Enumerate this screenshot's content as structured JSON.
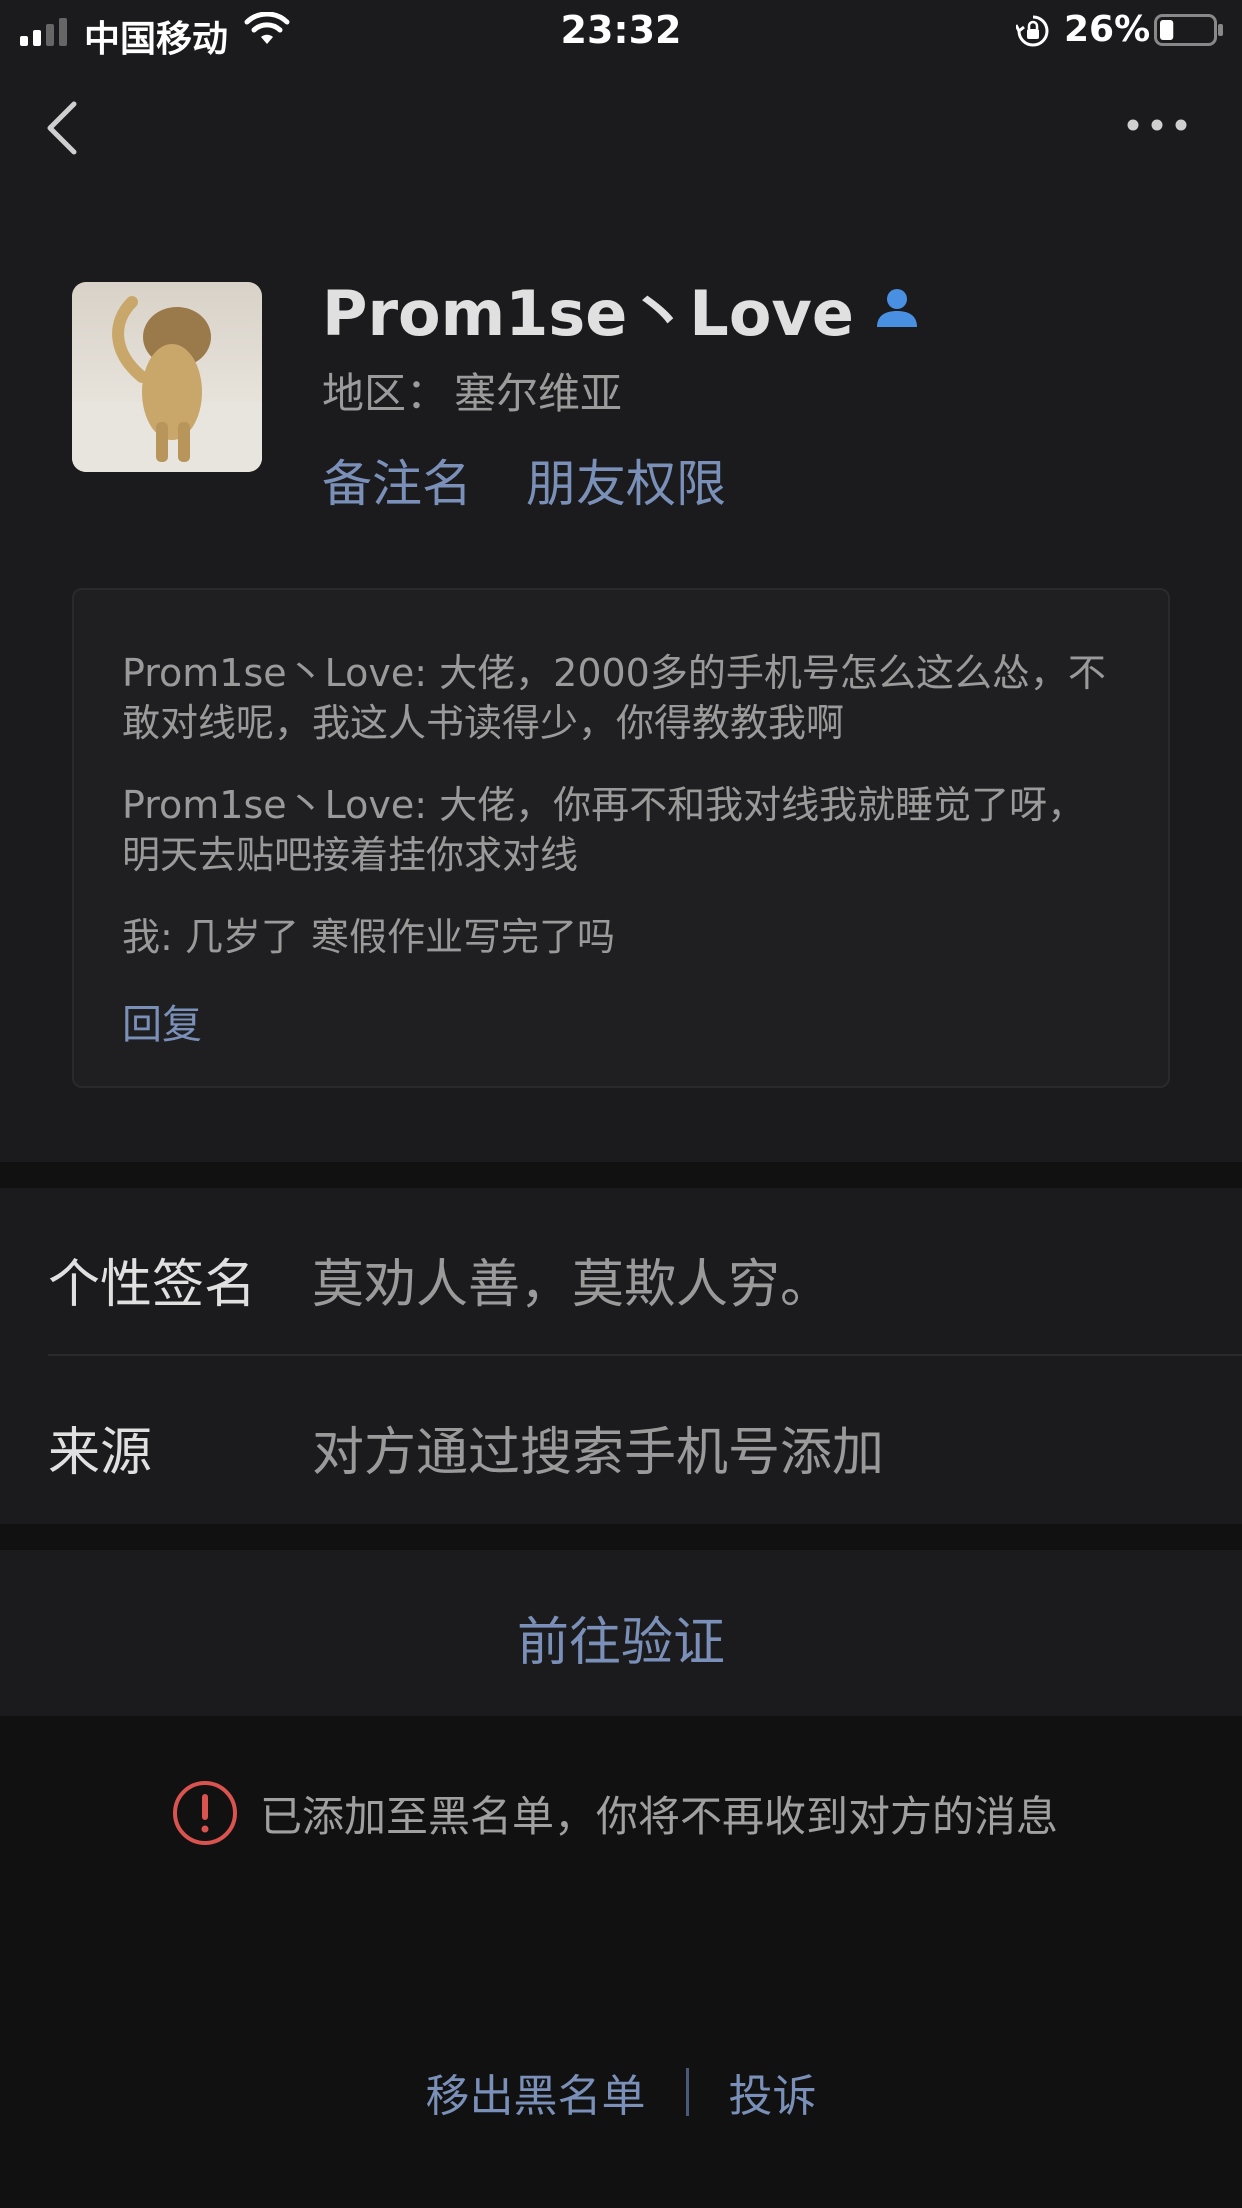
{
  "status_bar": {
    "carrier": "中国移动",
    "time": "23:32",
    "battery_percent": "26%",
    "battery_level": 0.26
  },
  "nav": {
    "back_icon": "chevron-left-icon",
    "more_icon": "more-horizontal-icon"
  },
  "profile": {
    "name": "Prom1se丶Love",
    "region_label": "地区：",
    "region_value": "塞尔维亚",
    "actions": [
      "备注名",
      "朋友权限"
    ]
  },
  "messages": {
    "items": [
      "Prom1se丶Love: 大佬，2000多的手机号怎么这么怂，不敢对线呢，我这人书读得少，你得教教我啊",
      "Prom1se丶Love: 大佬，你再不和我对线我就睡觉了呀，明天去贴吧接着挂你求对线",
      "我: 几岁了 寒假作业写完了吗"
    ],
    "reply_label": "回复"
  },
  "info": {
    "signature_label": "个性签名",
    "signature_value": "莫劝人善，莫欺人穷。",
    "source_label": "来源",
    "source_value": "对方通过搜索手机号添加"
  },
  "verify": {
    "label": "前往验证"
  },
  "notice": {
    "text": "已添加至黑名单，你将不再收到对方的消息"
  },
  "bottom": {
    "remove_blacklist": "移出黑名单",
    "report": "投诉"
  },
  "colors": {
    "background": "#111111",
    "panel": "#1b1b1d",
    "link": "#7a90b8",
    "warning": "#d9534f",
    "person_icon": "#4a90e2"
  }
}
